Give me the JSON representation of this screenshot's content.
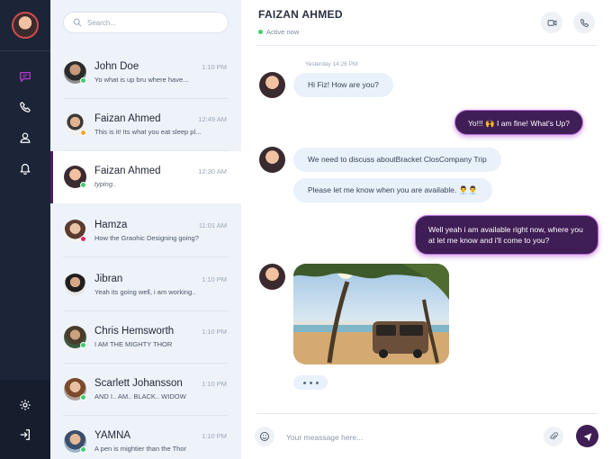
{
  "rail": {
    "icons": [
      "chat-icon",
      "phone-icon",
      "user-icon",
      "bell-icon",
      "gear-icon",
      "logout-icon"
    ],
    "accent": "#b13bcf"
  },
  "search": {
    "placeholder": "Search..."
  },
  "contacts": [
    {
      "name": "John Doe",
      "preview": "Yo what is up bru where have...",
      "time": "1:10 PM",
      "status": "online"
    },
    {
      "name": "Faizan Ahmed",
      "preview": "This is it! Its what you eat sleep pl...",
      "time": "12:49 AM",
      "status": "away"
    },
    {
      "name": "Faizan Ahmed",
      "preview": "typing..",
      "time": "12:30 AM",
      "status": "online"
    },
    {
      "name": "Hamza",
      "preview": "How the Graohic Designing going?",
      "time": "11:01 AM",
      "status": "busy"
    },
    {
      "name": "Jibran",
      "preview": "Yeah its going well, i am working..",
      "time": "1:10 PM",
      "status": "none"
    },
    {
      "name": "Chris Hemsworth",
      "preview": "I AM THE MIGHTY THOR",
      "time": "1:10 PM",
      "status": "online"
    },
    {
      "name": "Scarlett Johansson",
      "preview": "AND I.. AM.. BLACK.. WIDOW",
      "time": "1:10 PM",
      "status": "online"
    },
    {
      "name": "YAMNA",
      "preview": "A pen is mightier than the Thor",
      "time": "1:10 PM",
      "status": "online"
    }
  ],
  "chat": {
    "title": "FAIZAN AHMED",
    "status": "Active now",
    "date_label": "Yesterday 14:26 PM",
    "messages": [
      {
        "dir": "in",
        "text": "Hi  Fiz! How are you?"
      },
      {
        "dir": "out",
        "text": "Yo!!! 🙌 I am fine! What's Up?"
      },
      {
        "dir": "in",
        "text": "We need to discuss aboutBracket ClosCompany Trip"
      },
      {
        "dir": "in",
        "text": "Please let me know when you are available. 👨‍💼👨‍💼"
      },
      {
        "dir": "out",
        "text": "Well yeah i am available right now, where you at let me know and i'll come to you?"
      }
    ],
    "composer_placeholder": "Your meassage here..."
  },
  "colors": {
    "primary": "#3f1d55",
    "online": "#3ecf6e",
    "away": "#f5a623",
    "busy": "#e0245e"
  }
}
